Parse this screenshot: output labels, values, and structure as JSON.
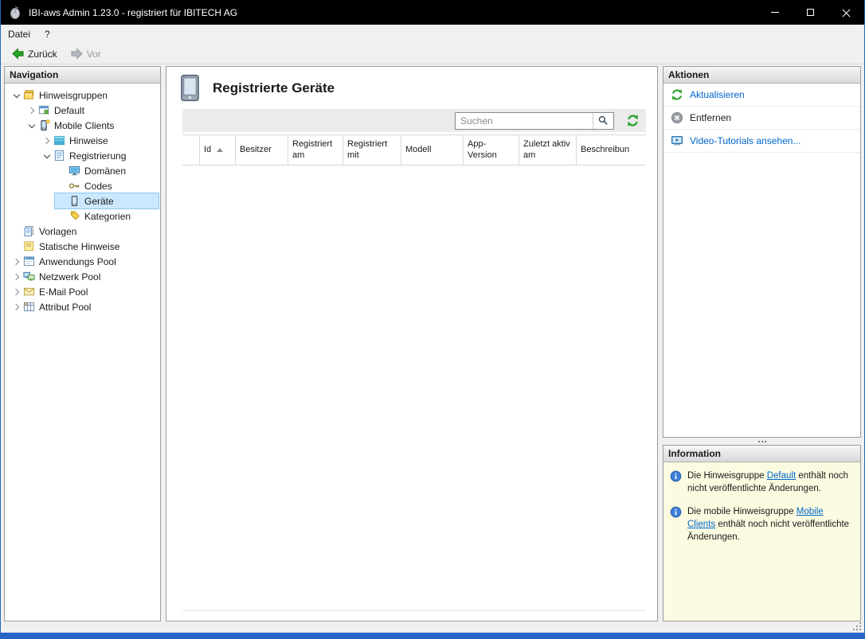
{
  "window": {
    "title": "IBI-aws Admin 1.23.0 - registriert für IBITECH AG"
  },
  "menu": {
    "items": [
      {
        "label": "Datei"
      },
      {
        "label": "?"
      }
    ]
  },
  "toolbar": {
    "back": "Zurück",
    "forward": "Vor"
  },
  "navigation": {
    "header": "Navigation",
    "tree": [
      {
        "label": "Hinweisgruppen",
        "level": 0,
        "state": "expanded",
        "icon": "hinweisgruppen-icon",
        "selected": false
      },
      {
        "label": "Default",
        "level": 1,
        "state": "collapsed",
        "icon": "default-group-icon",
        "selected": false
      },
      {
        "label": "Mobile Clients",
        "level": 1,
        "state": "expanded",
        "icon": "mobile-clients-icon",
        "selected": false
      },
      {
        "label": "Hinweise",
        "level": 2,
        "state": "collapsed",
        "icon": "hinweise-icon",
        "selected": false
      },
      {
        "label": "Registrierung",
        "level": 2,
        "state": "expanded",
        "icon": "registrierung-icon",
        "selected": false
      },
      {
        "label": "Domänen",
        "level": 3,
        "state": "leaf",
        "icon": "domaenen-icon",
        "selected": false
      },
      {
        "label": "Codes",
        "level": 3,
        "state": "leaf",
        "icon": "codes-icon",
        "selected": false
      },
      {
        "label": "Geräte",
        "level": 3,
        "state": "leaf",
        "icon": "geraete-icon",
        "selected": true
      },
      {
        "label": "Kategorien",
        "level": 3,
        "state": "leaf",
        "icon": "kategorien-icon",
        "selected": false
      },
      {
        "label": "Vorlagen",
        "level": 0,
        "state": "leaf",
        "icon": "vorlagen-icon",
        "selected": false
      },
      {
        "label": "Statische Hinweise",
        "level": 0,
        "state": "leaf",
        "icon": "statische-hinweise-icon",
        "selected": false
      },
      {
        "label": "Anwendungs Pool",
        "level": 0,
        "state": "collapsed",
        "icon": "anwendungs-pool-icon",
        "selected": false
      },
      {
        "label": "Netzwerk Pool",
        "level": 0,
        "state": "collapsed",
        "icon": "netzwerk-pool-icon",
        "selected": false
      },
      {
        "label": "E-Mail Pool",
        "level": 0,
        "state": "collapsed",
        "icon": "email-pool-icon",
        "selected": false
      },
      {
        "label": "Attribut Pool",
        "level": 0,
        "state": "collapsed",
        "icon": "attribut-pool-icon",
        "selected": false
      }
    ]
  },
  "main": {
    "title": "Registrierte Geräte",
    "search": {
      "placeholder": "Suchen",
      "value": ""
    },
    "table": {
      "columns": [
        {
          "label": "Id",
          "sorted": "asc"
        },
        {
          "label": "Besitzer"
        },
        {
          "label": "Registriert am"
        },
        {
          "label": "Registriert mit"
        },
        {
          "label": "Modell"
        },
        {
          "label": "App-Version"
        },
        {
          "label": "Zuletzt aktiv am"
        },
        {
          "label": "Beschreibun"
        }
      ],
      "rows": []
    }
  },
  "actions": {
    "header": "Aktionen",
    "items": [
      {
        "label": "Aktualisieren",
        "icon": "refresh-icon",
        "style": "link"
      },
      {
        "label": "Entfernen",
        "icon": "remove-icon",
        "style": "normal"
      },
      {
        "label": "Video-Tutorials ansehen...",
        "icon": "video-icon",
        "style": "link"
      }
    ]
  },
  "information": {
    "header": "Information",
    "items": [
      {
        "prefix": "Die Hinweisgruppe ",
        "link": "Default",
        "suffix": " enthält noch nicht veröffentlichte Änderungen."
      },
      {
        "prefix": "Die mobile Hinweisgruppe ",
        "link": "Mobile Clients",
        "suffix": " enthält noch nicht veröffentlichte Änderungen."
      }
    ]
  },
  "colors": {
    "titlebar": "#000000",
    "accent_border": "#2766c4",
    "link": "#0066cc",
    "tree_selection": "#cce8ff",
    "info_panel_bg": "#fbfbe1",
    "refresh_green": "#2ea52e"
  }
}
